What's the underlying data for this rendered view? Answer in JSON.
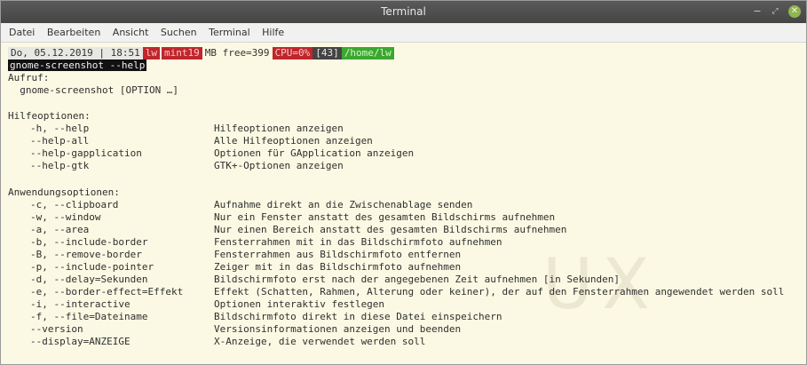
{
  "window": {
    "title": "Terminal"
  },
  "menu": [
    "Datei",
    "Bearbeiten",
    "Ansicht",
    "Suchen",
    "Terminal",
    "Hilfe"
  ],
  "prompt": {
    "date": "Do, 05.12.2019 | 18:51",
    "user": "lw",
    "host": "mint19",
    "mem": "MB free=399",
    "cpu": "CPU=0%",
    "jobs": "[43]",
    "path": "/home/lw"
  },
  "command": "gnome-screenshot --help",
  "usage": {
    "heading": "Aufruf:",
    "line": "  gnome-screenshot [OPTION …]"
  },
  "help_section": {
    "heading": "Hilfeoptionen:",
    "options": [
      {
        "opt": "-h, --help",
        "desc": "Hilfeoptionen anzeigen"
      },
      {
        "opt": "--help-all",
        "desc": "Alle Hilfeoptionen anzeigen"
      },
      {
        "opt": "--help-gapplication",
        "desc": "Optionen für GApplication anzeigen"
      },
      {
        "opt": "--help-gtk",
        "desc": "GTK+-Optionen anzeigen"
      }
    ]
  },
  "app_section": {
    "heading": "Anwendungsoptionen:",
    "options": [
      {
        "opt": "-c, --clipboard",
        "desc": "Aufnahme direkt an die Zwischenablage senden"
      },
      {
        "opt": "-w, --window",
        "desc": "Nur ein Fenster anstatt des gesamten Bildschirms aufnehmen"
      },
      {
        "opt": "-a, --area",
        "desc": "Nur einen Bereich anstatt des gesamten Bildschirms aufnehmen"
      },
      {
        "opt": "-b, --include-border",
        "desc": "Fensterrahmen mit in das Bildschirmfoto aufnehmen"
      },
      {
        "opt": "-B, --remove-border",
        "desc": "Fensterrahmen aus Bildschirmfoto entfernen"
      },
      {
        "opt": "-p, --include-pointer",
        "desc": "Zeiger mit in das Bildschirmfoto aufnehmen"
      },
      {
        "opt": "-d, --delay=Sekunden",
        "desc": "Bildschirmfoto erst nach der angegebenen Zeit aufnehmen [in Sekunden]"
      },
      {
        "opt": "-e, --border-effect=Effekt",
        "desc": "Effekt (Schatten, Rahmen, Alterung oder keiner), der auf den Fensterrahmen angewendet werden soll"
      },
      {
        "opt": "-i, --interactive",
        "desc": "Optionen interaktiv festlegen"
      },
      {
        "opt": "-f, --file=Dateiname",
        "desc": "Bildschirmfoto direkt in diese Datei einspeichern"
      },
      {
        "opt": "--version",
        "desc": "Versionsinformationen anzeigen und beenden"
      },
      {
        "opt": "--display=ANZEIGE",
        "desc": "X-Anzeige, die verwendet werden soll"
      }
    ]
  },
  "icons": {
    "minimize": "minimize-icon",
    "maximize": "maximize-icon",
    "close": "close-icon"
  },
  "colors": {
    "titlebar": "#4e4e4e",
    "background": "#fbf9e3",
    "prompt_red": "#c0262b",
    "prompt_green": "#3aa830",
    "close_button": "#8fb74b"
  }
}
